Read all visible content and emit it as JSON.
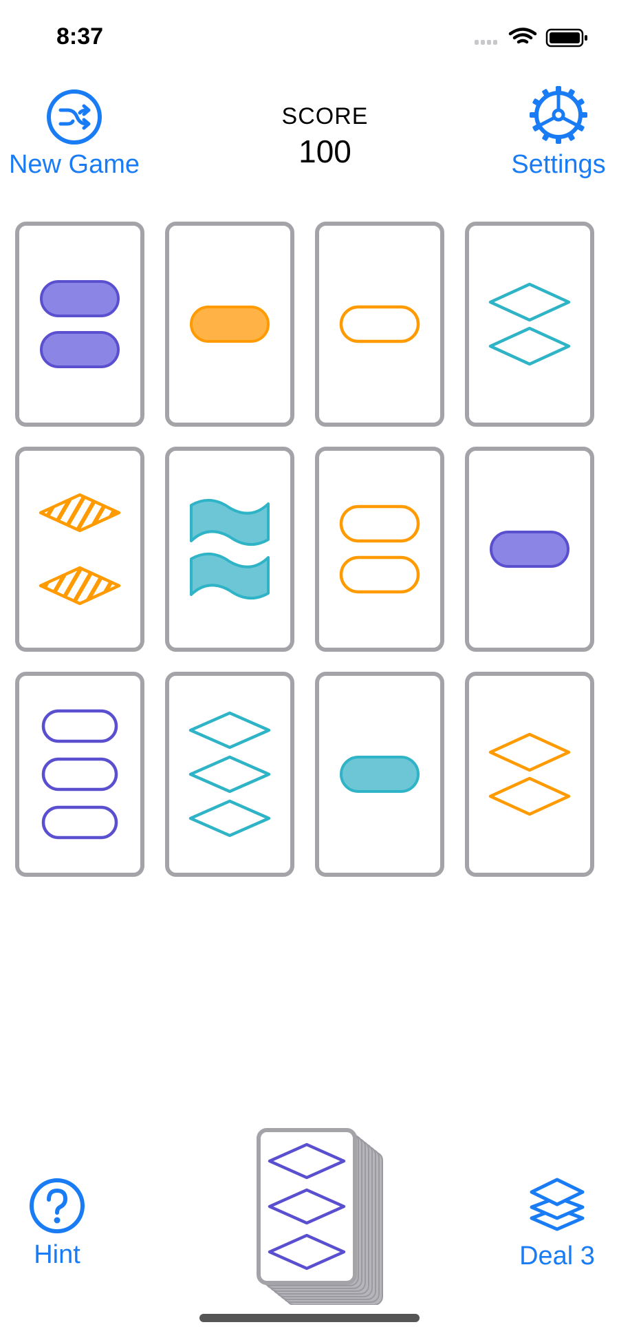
{
  "status_bar": {
    "time": "8:37"
  },
  "header": {
    "new_game_label": "New Game",
    "settings_label": "Settings",
    "score_title": "SCORE",
    "score_value": "100"
  },
  "colors": {
    "accent": "#1a7cf4",
    "purple": "#5a4fcf",
    "purple_fill": "#8b85e6",
    "orange": "#ff9b00",
    "orange_fill": "#ffb347",
    "teal": "#2fb3c6",
    "teal_fill": "#6cc6d6",
    "card_border": "#a3a3a8"
  },
  "cards": [
    {
      "count": 2,
      "shape": "oval",
      "shading": "solid",
      "color": "purple"
    },
    {
      "count": 1,
      "shape": "oval",
      "shading": "solid",
      "color": "orange"
    },
    {
      "count": 1,
      "shape": "oval",
      "shading": "open",
      "color": "orange"
    },
    {
      "count": 2,
      "shape": "diamond",
      "shading": "open",
      "color": "teal"
    },
    {
      "count": 2,
      "shape": "diamond",
      "shading": "striped",
      "color": "orange"
    },
    {
      "count": 2,
      "shape": "squiggle",
      "shading": "solid",
      "color": "teal"
    },
    {
      "count": 2,
      "shape": "oval",
      "shading": "open",
      "color": "orange"
    },
    {
      "count": 1,
      "shape": "oval",
      "shading": "solid",
      "color": "purple"
    },
    {
      "count": 3,
      "shape": "oval",
      "shading": "open",
      "color": "purple"
    },
    {
      "count": 3,
      "shape": "diamond",
      "shading": "open",
      "color": "teal"
    },
    {
      "count": 1,
      "shape": "oval",
      "shading": "solid",
      "color": "teal"
    },
    {
      "count": 2,
      "shape": "diamond",
      "shading": "open",
      "color": "orange"
    }
  ],
  "deck_top_card": {
    "count": 3,
    "shape": "diamond",
    "shading": "open",
    "color": "purple"
  },
  "footer": {
    "hint_label": "Hint",
    "deal_label": "Deal 3"
  },
  "icons": {
    "new_game": "shuffle-icon",
    "settings": "gear-icon",
    "hint": "question-circle-icon",
    "deal": "stack-icon"
  }
}
